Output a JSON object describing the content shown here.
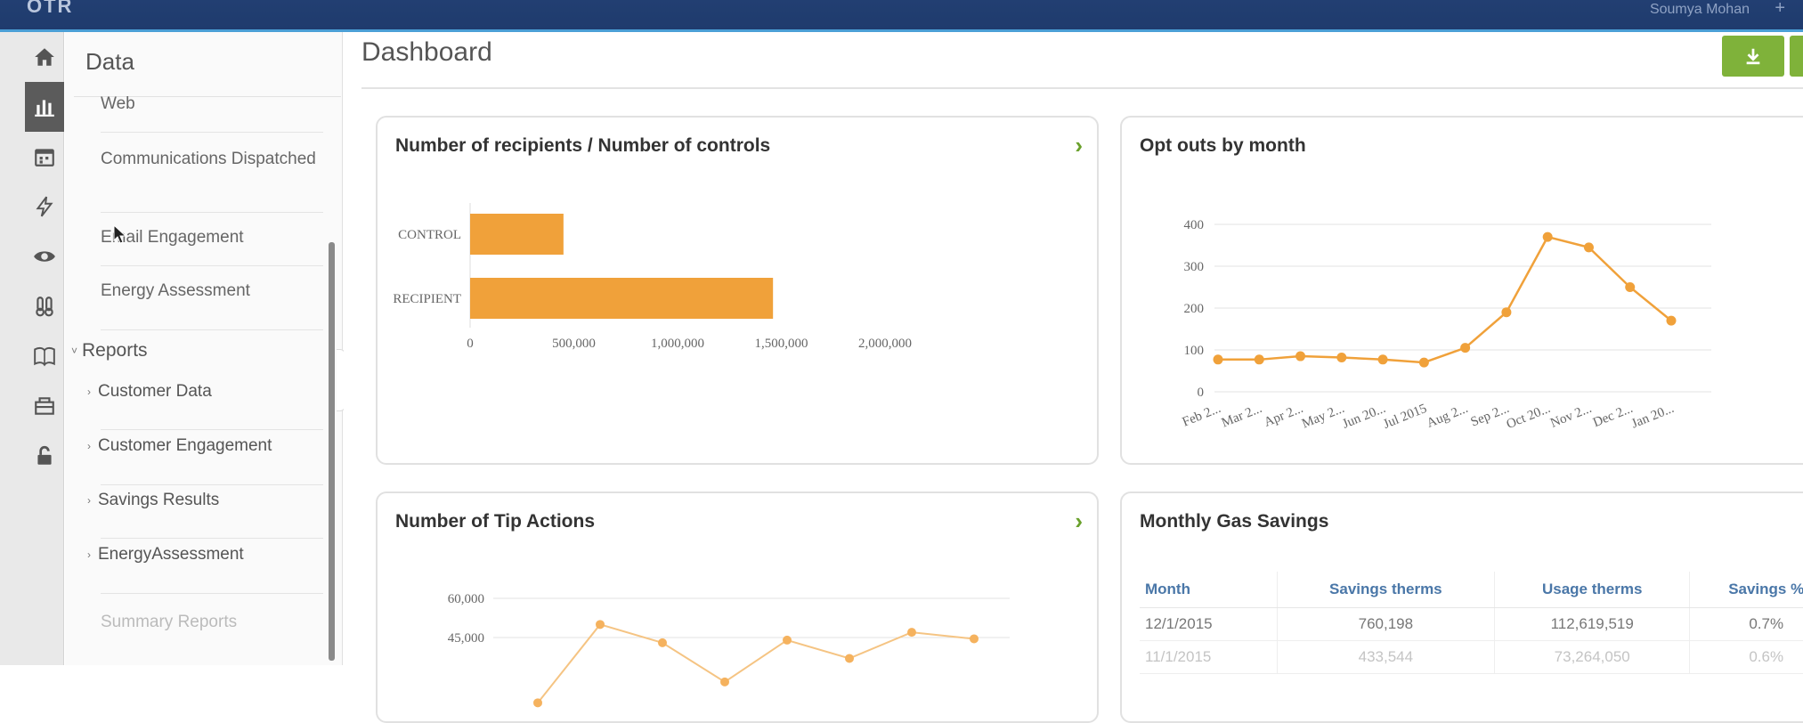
{
  "topbar": {
    "logo": "OTR",
    "user": "Soumya Mohan",
    "plus": "+"
  },
  "icon_rail": [
    "home-icon",
    "bar-chart-icon",
    "calendar-icon",
    "lightning-icon",
    "eye-icon",
    "thermometer-icon",
    "book-icon",
    "inbox-icon",
    "lock-icon"
  ],
  "sidebar": {
    "heading": "Data",
    "data_items": [
      "Web",
      "Communications Dispatched",
      "Email Engagement",
      "Energy Assessment"
    ],
    "reports_label": "Reports",
    "report_items": [
      "Customer Data",
      "Customer Engagement",
      "Savings Results",
      "EnergyAssessment"
    ],
    "summary_reports": "Summary Reports"
  },
  "main": {
    "title": "Dashboard",
    "download_icon": "download-icon",
    "cards": [
      {
        "title": "Number of recipients / Number of controls"
      },
      {
        "title": "Opt outs by month"
      },
      {
        "title": "Number of Tip Actions"
      },
      {
        "title": "Monthly Gas Savings"
      }
    ]
  },
  "colors": {
    "accent": "#f0a13a",
    "action_green": "#7fb23a",
    "header_navy": "#1f3b6d",
    "table_header": "#4a77a8"
  },
  "chart_data": [
    {
      "type": "bar",
      "orientation": "horizontal",
      "categories": [
        "CONTROL",
        "RECIPIENT"
      ],
      "values": [
        450000,
        1460000
      ],
      "title": "Number of recipients / Number of controls",
      "xlim": [
        0,
        2000000
      ],
      "xticks": [
        "0",
        "500,000",
        "1,000,000",
        "1,500,000",
        "2,000,000"
      ]
    },
    {
      "type": "line",
      "title": "Opt outs by month",
      "x": [
        "Feb 2...",
        "Mar 2...",
        "Apr 2...",
        "May 2...",
        "Jun 20...",
        "Jul 2015",
        "Aug 2...",
        "Sep 2...",
        "Oct 20...",
        "Nov 2...",
        "Dec 2...",
        "Jan 20..."
      ],
      "values": [
        77,
        77,
        85,
        82,
        77,
        70,
        105,
        190,
        370,
        345,
        250,
        170
      ],
      "ylim": [
        0,
        400
      ],
      "yticks": [
        "0",
        "100",
        "200",
        "300",
        "400"
      ]
    },
    {
      "type": "line",
      "title": "Number of Tip Actions",
      "visible_yticks": [
        "60,000",
        "45,000"
      ],
      "values": [
        20000,
        50000,
        43000,
        28000,
        44000,
        37000,
        47000,
        44500
      ]
    },
    {
      "type": "table",
      "title": "Monthly Gas Savings",
      "columns": [
        "Month",
        "Savings therms",
        "Usage therms",
        "Savings %"
      ],
      "rows": [
        [
          "12/1/2015",
          "760,198",
          "112,619,519",
          "0.7%"
        ],
        [
          "11/1/2015",
          "433,544",
          "73,264,050",
          "0.6%"
        ]
      ]
    }
  ]
}
